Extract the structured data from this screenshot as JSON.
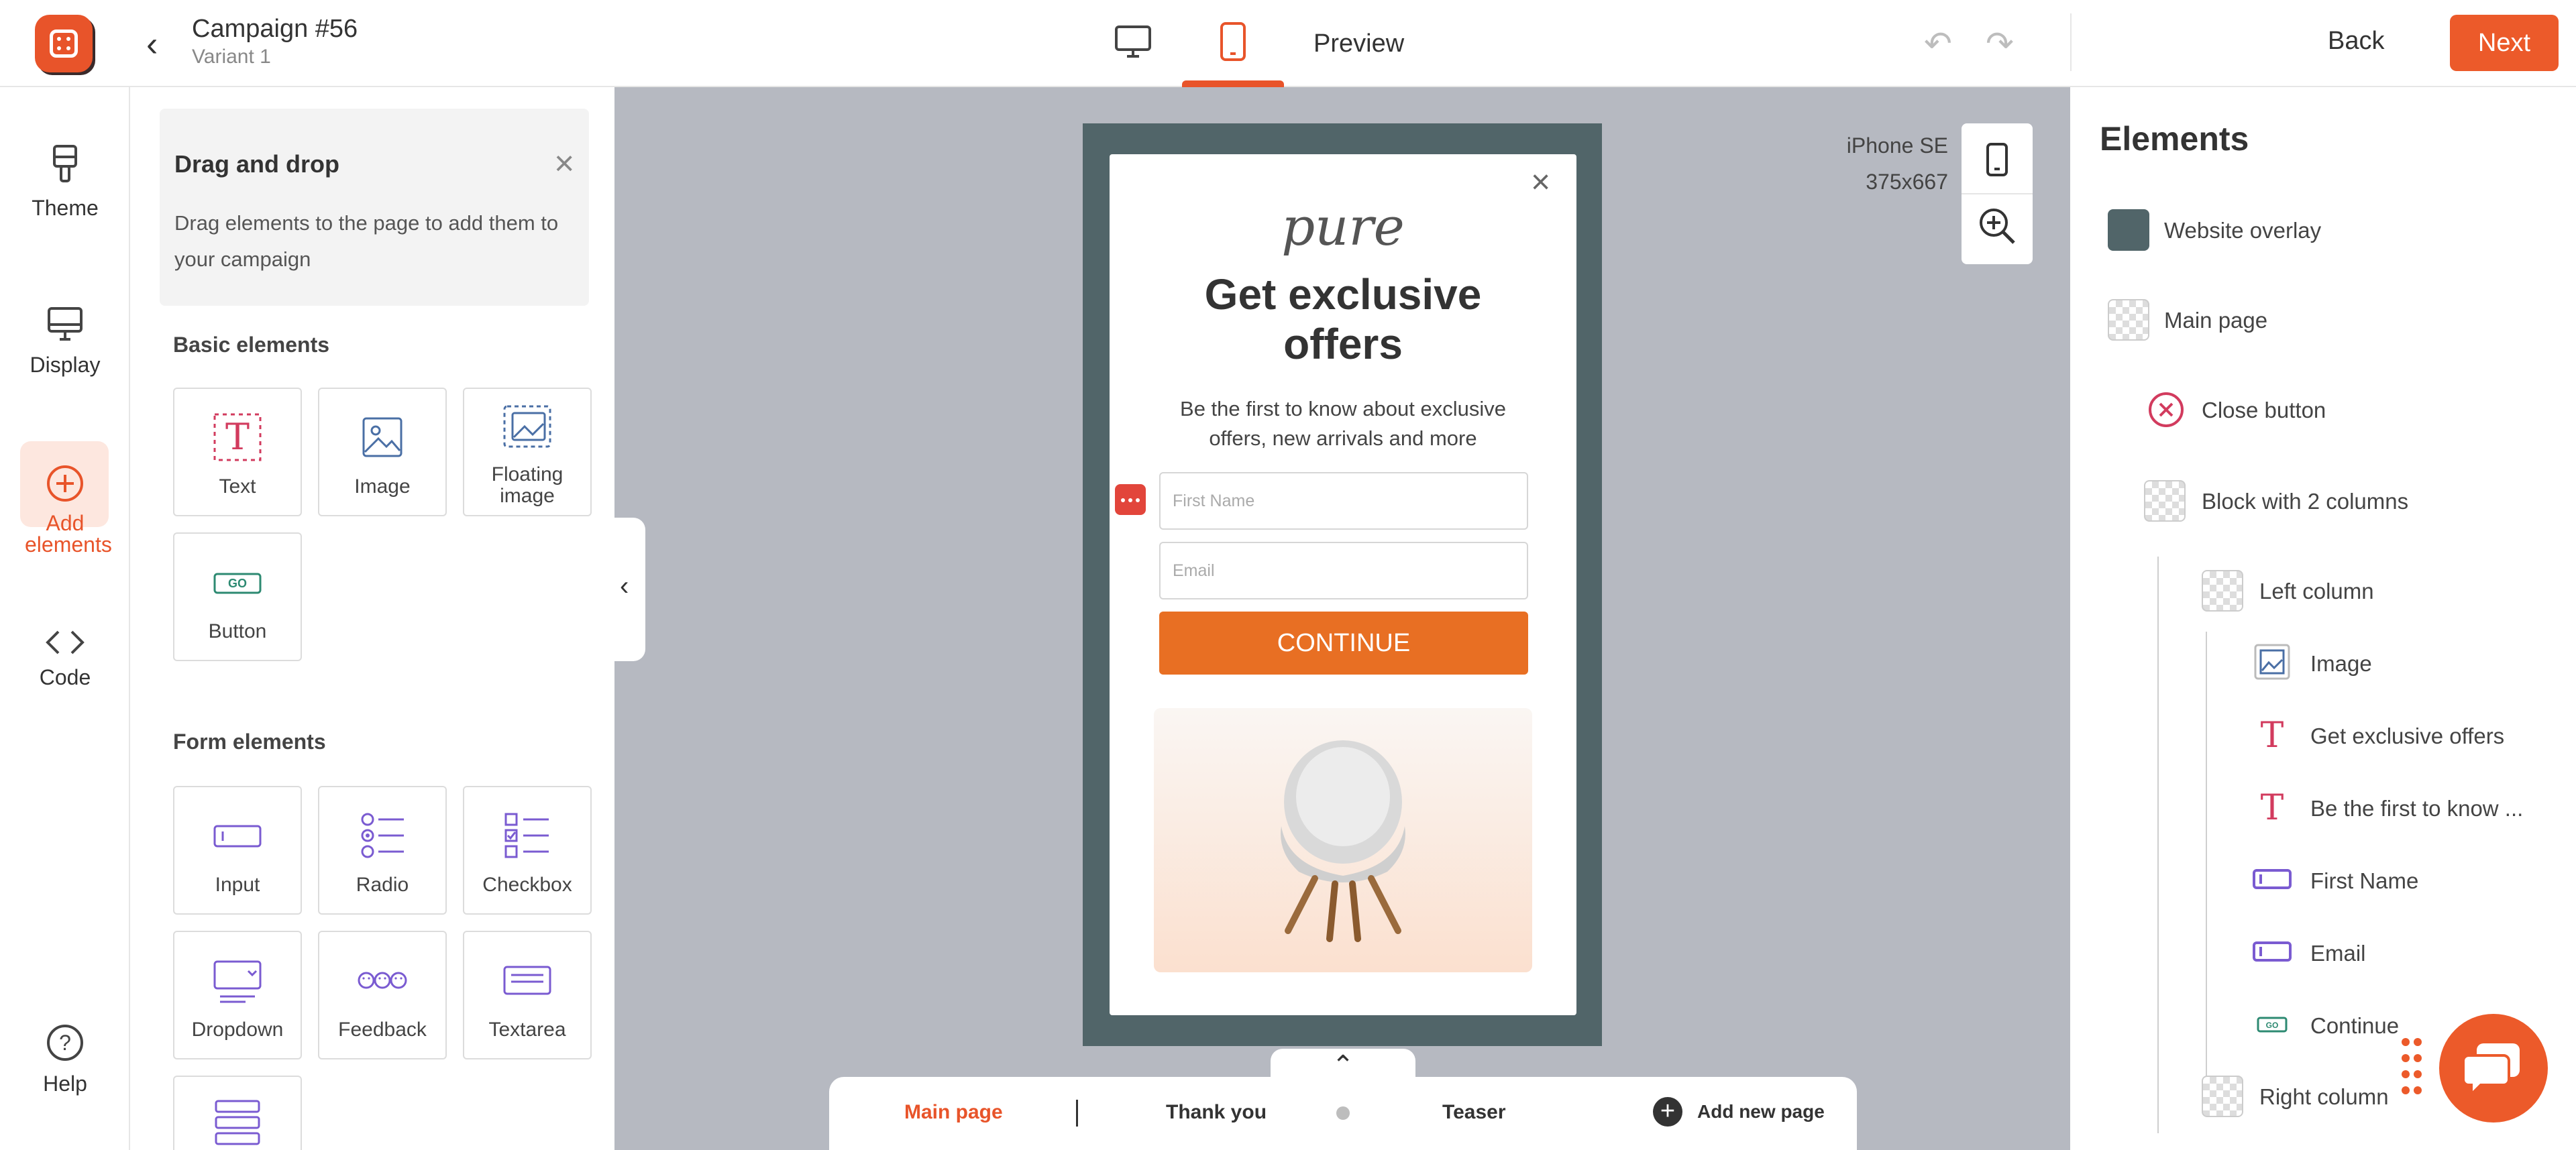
{
  "topbar": {
    "campaign_title": "Campaign #56",
    "variant": "Variant 1",
    "preview_label": "Preview",
    "back_label": "Back",
    "next_label": "Next",
    "accent_color": "#ec5a2a"
  },
  "rail": {
    "theme": "Theme",
    "display": "Display",
    "add_elements": "Add elements",
    "code": "Code",
    "help": "Help"
  },
  "palette": {
    "dd_title": "Drag and drop",
    "dd_text": "Drag elements to the page to add them to your campaign",
    "basic_title": "Basic elements",
    "basic": [
      "Text",
      "Image",
      "Floating image",
      "Button"
    ],
    "form_title": "Form elements",
    "form": [
      "Input",
      "Radio",
      "Checkbox",
      "Dropdown",
      "Feedback",
      "Textarea"
    ]
  },
  "canvas": {
    "device_name": "iPhone SE",
    "device_size": "375x667",
    "popup": {
      "brand": "pure",
      "headline": "Get exclusive offers",
      "subtext": "Be the first to know about exclusive offers, new arrivals and more",
      "first_name_placeholder": "First Name",
      "email_placeholder": "Email",
      "cta": "CONTINUE",
      "overlay_color": "#516569"
    }
  },
  "pages": {
    "main": "Main page",
    "thank_you": "Thank you",
    "teaser": "Teaser",
    "add": "Add new page"
  },
  "layers": {
    "title": "Elements",
    "items": [
      "Website overlay",
      "Main page",
      "Close button",
      "Block with 2 columns",
      "Left column",
      "Image",
      "Get exclusive offers",
      "Be the first to know ...",
      "First Name",
      "Email",
      "Continue",
      "Right column"
    ]
  }
}
